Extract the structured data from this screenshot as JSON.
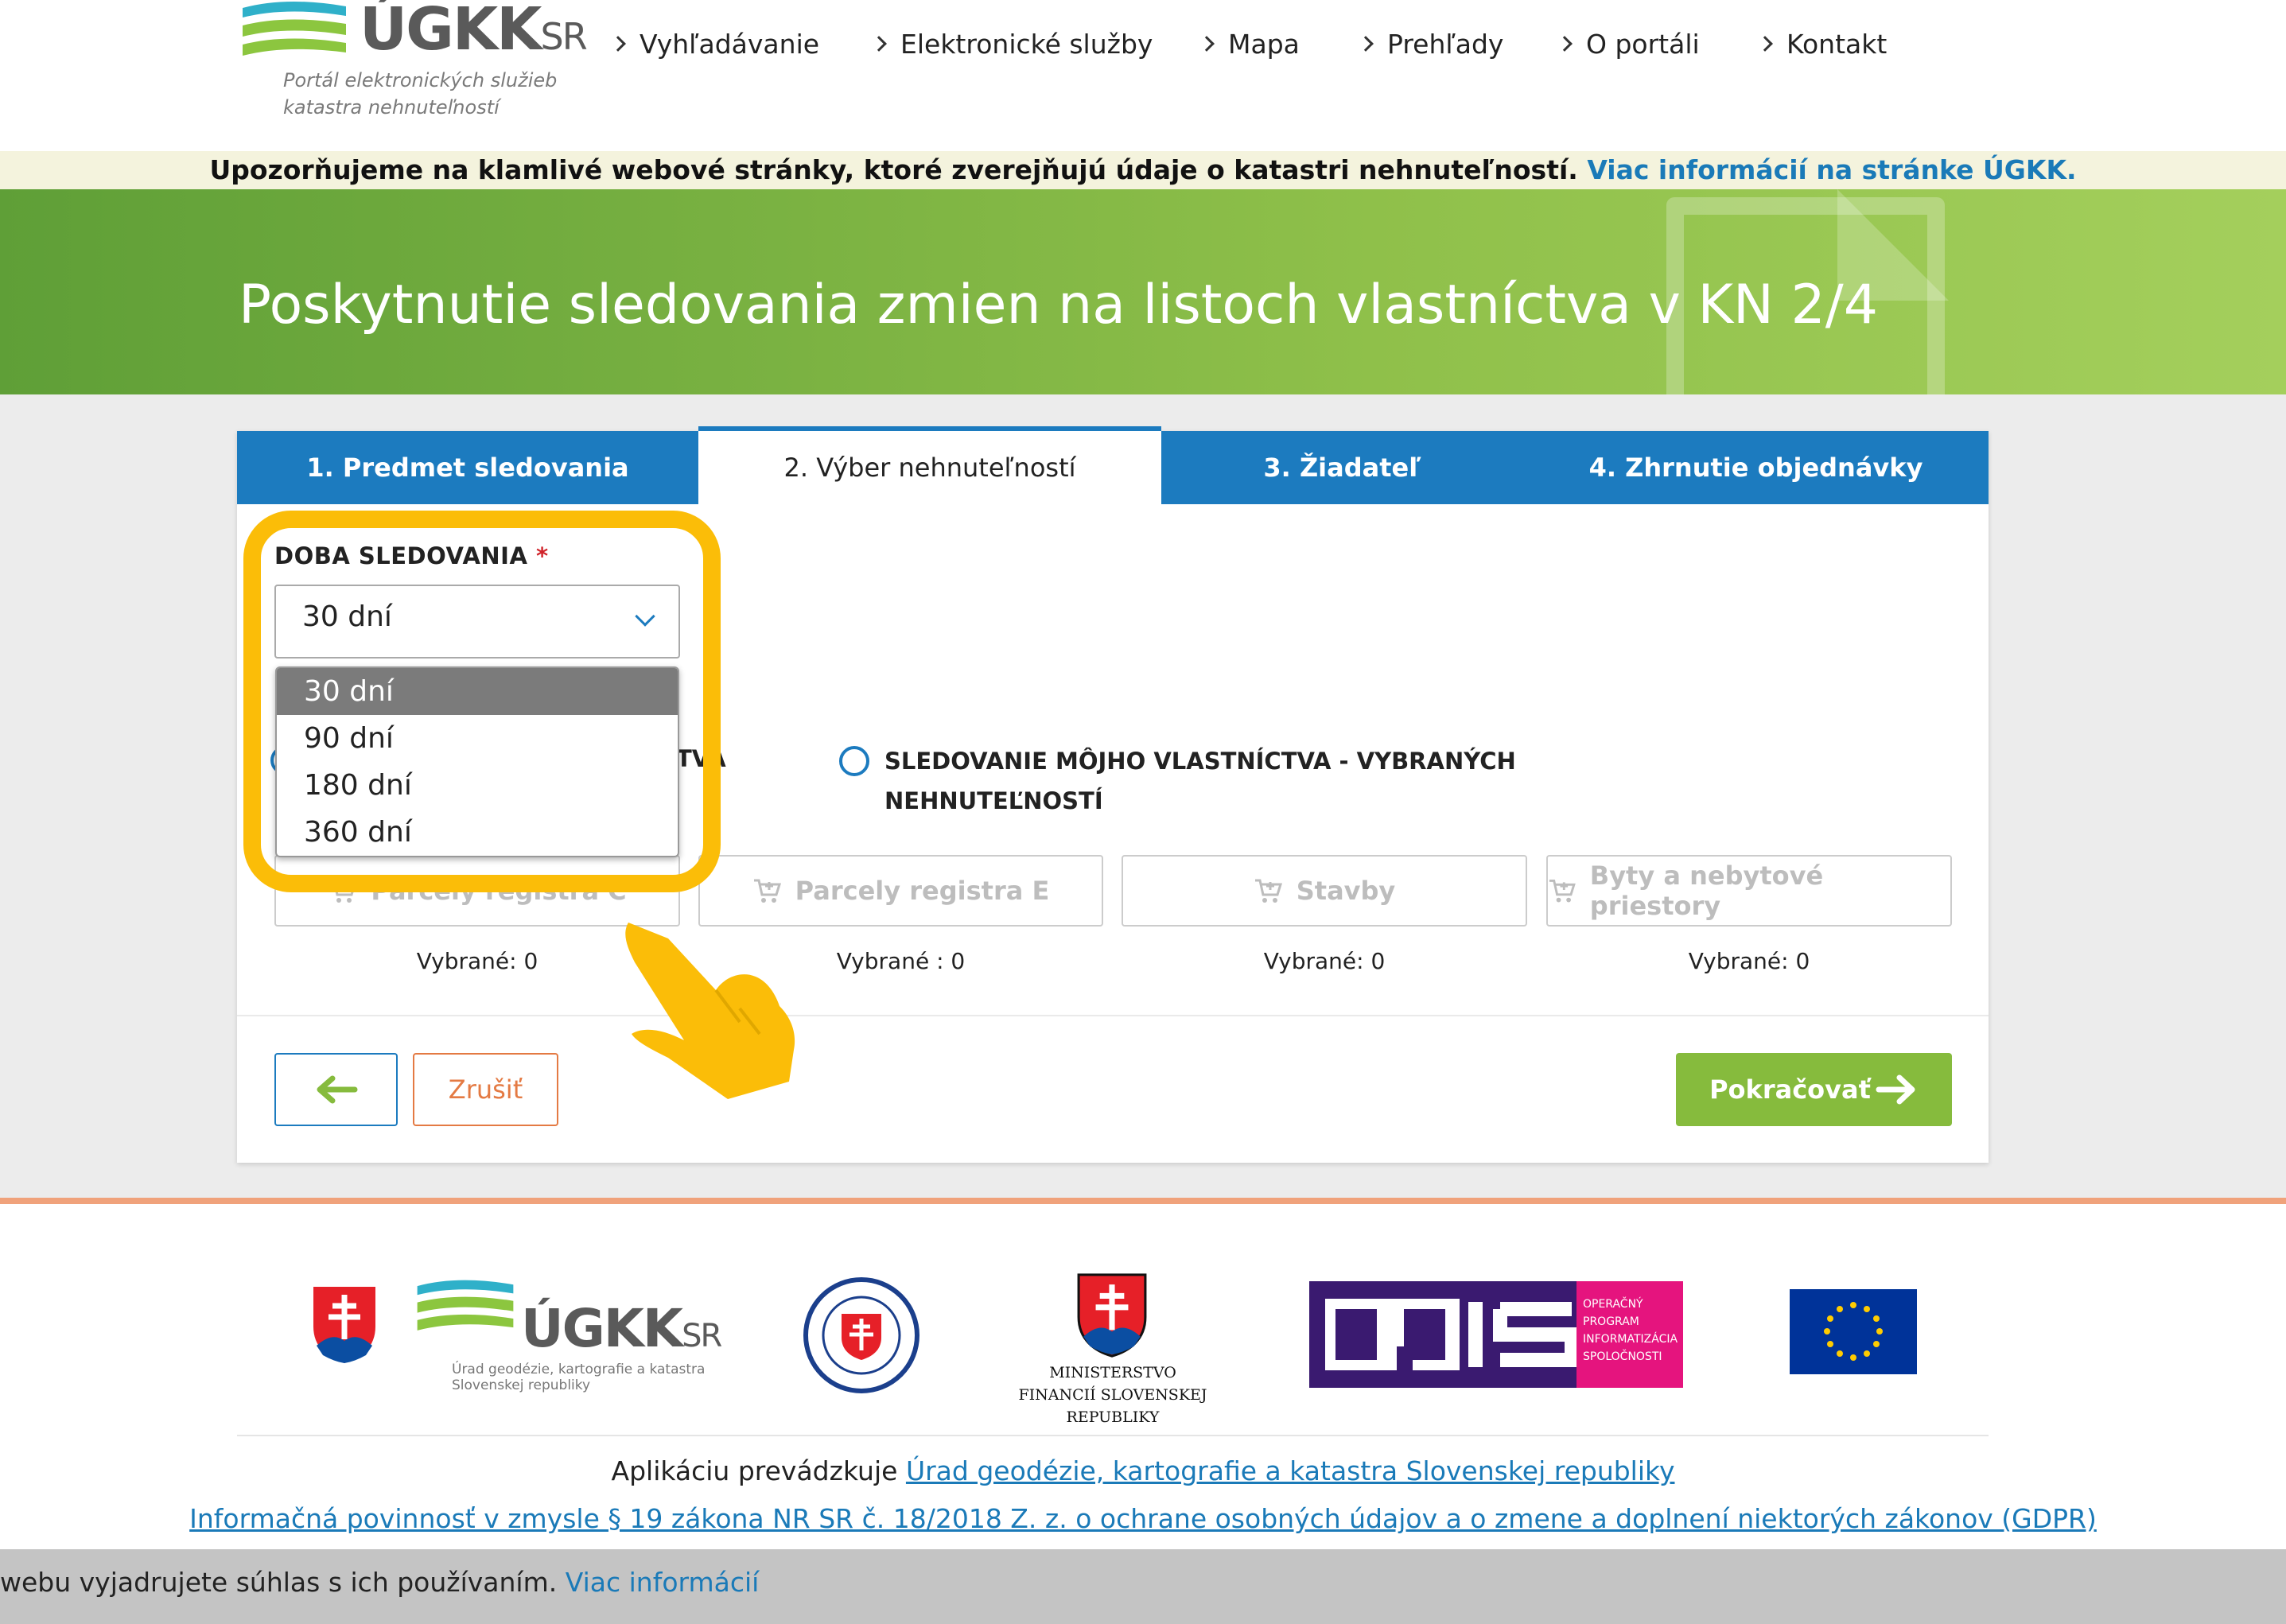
{
  "header": {
    "logo_text": "ÚGKK",
    "logo_suffix": "SR",
    "logo_subtitle": "Portál elektronických služieb katastra nehnuteľností",
    "nav": [
      {
        "label": "Vyhľadávanie"
      },
      {
        "label": "Elektronické služby"
      },
      {
        "label": "Mapa"
      },
      {
        "label": "Prehľady"
      },
      {
        "label": "O portáli"
      },
      {
        "label": "Kontakt"
      }
    ]
  },
  "warning": {
    "text": "Upozorňujeme na klamlivé webové stránky, ktoré zverejňujú údaje o katastri nehnuteľností.",
    "link": "Viac informácií na stránke ÚGKK."
  },
  "banner": {
    "title": "Poskytnutie sledovania zmien na listoch vlastníctva v KN 2/4"
  },
  "tabs": [
    {
      "label": "1. Predmet sledovania",
      "active": false
    },
    {
      "label": "2. Výber nehnuteľností",
      "active": true
    },
    {
      "label": "3. Žiadateľ",
      "active": false
    },
    {
      "label": "4. Zhrnutie objednávky",
      "active": false
    }
  ],
  "form": {
    "duration_label": "DOBA SLEDOVANIA",
    "required_mark": "*",
    "selected_value": "30 dní",
    "options": [
      "30 dní",
      "90 dní",
      "180 dní",
      "360 dní"
    ],
    "radio1_fragment": "TVA",
    "radio2_label": "SLEDOVANIE MÔJHO VLASTNÍCTVA - VYBRANÝCH NEHNUTEĽNOSTÍ"
  },
  "categories": [
    {
      "label": "Parcely registra C",
      "selected": "Vybrané: 0"
    },
    {
      "label": "Parcely registra E",
      "selected": "Vybrané : 0"
    },
    {
      "label": "Stavby",
      "selected": "Vybrané: 0"
    },
    {
      "label": "Byty a nebytové priestory",
      "selected": "Vybrané: 0"
    }
  ],
  "actions": {
    "cancel": "Zrušiť",
    "next": "Pokračovať"
  },
  "footer": {
    "ugkk_logo_text": "ÚGKK",
    "ugkk_logo_suffix": "SR",
    "ugkk_sub": "Úrad geodézie, kartografie a katastra Slovenskej republiky",
    "mf_text": "MINISTERSTVO FINANCIÍ SLOVENSKEJ REPUBLIKY",
    "opis_text": "OPERAČNÝ PROGRAM INFORMATIZÁCIA SPOLOČNOSTI",
    "operator_prefix": "Aplikáciu prevádzkuje",
    "operator_link": "Úrad geodézie, kartografie a katastra Slovenskej republiky",
    "gdpr_link": "Informačná povinnosť v zmysle § 19 zákona NR SR č. 18/2018 Z. z. o ochrane osobných údajov a o zmene a doplnení niektorých zákonov (GDPR)"
  },
  "cookie": {
    "text": "webu vyjadrujete súhlas s ich používaním.",
    "link": "Viac informácií"
  },
  "colors": {
    "primary_blue": "#1c7bbf",
    "green": "#86bb3d",
    "highlight": "#fbbd08",
    "cancel_orange": "#e47a43"
  }
}
